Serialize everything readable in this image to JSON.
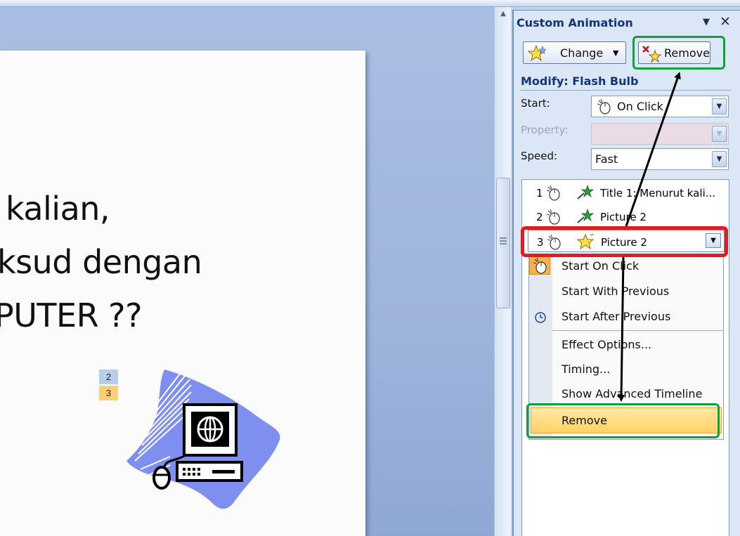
{
  "pane": {
    "title": "Custom Animation",
    "change_label": "Change",
    "remove_label": "Remove",
    "modify_label": "Modify: Flash Bulb",
    "start_label": "Start:",
    "start_value": "On Click",
    "property_label": "Property:",
    "property_value": "",
    "speed_label": "Speed:",
    "speed_value": "Fast"
  },
  "animation_list": [
    {
      "num": "1",
      "name": "Title 1: Menurut kali...",
      "effect_icon": "green-star-icon"
    },
    {
      "num": "2",
      "name": "Picture 2",
      "effect_icon": "green-star-icon"
    },
    {
      "num": "3",
      "name": "Picture 2",
      "effect_icon": "flash-bulb-star-icon"
    }
  ],
  "context_menu": {
    "items": [
      {
        "label": "Start On Click",
        "icon": "mouse-icon"
      },
      {
        "label": "Start With Previous"
      },
      {
        "label": "Start After Previous",
        "icon": "clock-icon"
      },
      {
        "label": "Effect Options..."
      },
      {
        "label": "Timing..."
      },
      {
        "label": "Show Advanced Timeline"
      },
      {
        "label": "Remove"
      }
    ]
  },
  "slide": {
    "line1": "kalian,",
    "line2": "ksud dengan",
    "line3": "PUTER ??",
    "tag_2": "2",
    "tag_3": "3"
  },
  "colors": {
    "pane_title": "#12357a",
    "highlight_green": "#11a13a",
    "highlight_red": "#e01b22",
    "menu_hover": "#ffd165"
  }
}
